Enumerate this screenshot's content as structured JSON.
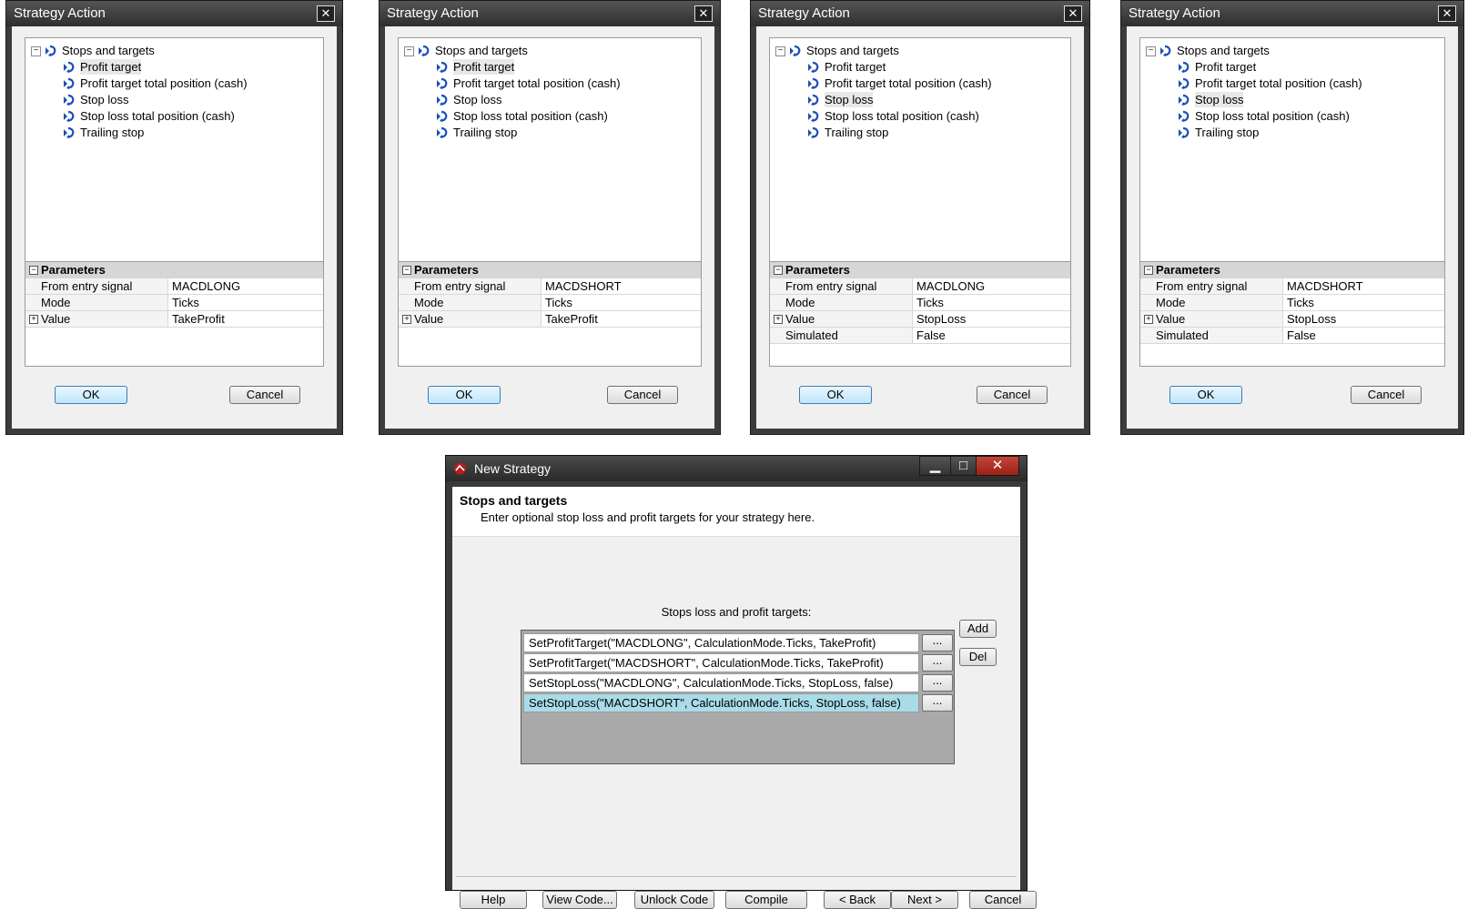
{
  "dialogs": [
    {
      "title": "Strategy Action",
      "close": "✕",
      "tree": {
        "root": "Stops and targets",
        "expander": "−",
        "items": [
          "Profit target",
          "Profit target total position (cash)",
          "Stop loss",
          "Stop loss total position (cash)",
          "Trailing stop"
        ],
        "selected_index": 0
      },
      "params": {
        "header": "Parameters",
        "rows": [
          {
            "name": "From entry signal",
            "value": "MACDLONG"
          },
          {
            "name": "Mode",
            "value": "Ticks"
          },
          {
            "name": "Value",
            "value": "TakeProfit",
            "expandable": true
          }
        ]
      },
      "ok": "OK",
      "cancel": "Cancel"
    },
    {
      "title": "Strategy Action",
      "close": "✕",
      "tree": {
        "root": "Stops and targets",
        "expander": "−",
        "items": [
          "Profit target",
          "Profit target total position (cash)",
          "Stop loss",
          "Stop loss total position (cash)",
          "Trailing stop"
        ],
        "selected_index": 0
      },
      "params": {
        "header": "Parameters",
        "rows": [
          {
            "name": "From entry signal",
            "value": "MACDSHORT"
          },
          {
            "name": "Mode",
            "value": "Ticks"
          },
          {
            "name": "Value",
            "value": "TakeProfit",
            "expandable": true
          }
        ]
      },
      "ok": "OK",
      "cancel": "Cancel"
    },
    {
      "title": "Strategy Action",
      "close": "✕",
      "tree": {
        "root": "Stops and targets",
        "expander": "−",
        "items": [
          "Profit target",
          "Profit target total position (cash)",
          "Stop loss",
          "Stop loss total position (cash)",
          "Trailing stop"
        ],
        "selected_index": 2
      },
      "params": {
        "header": "Parameters",
        "rows": [
          {
            "name": "From entry signal",
            "value": "MACDLONG"
          },
          {
            "name": "Mode",
            "value": "Ticks"
          },
          {
            "name": "Value",
            "value": "StopLoss",
            "expandable": true
          },
          {
            "name": "Simulated",
            "value": "False"
          }
        ]
      },
      "ok": "OK",
      "cancel": "Cancel"
    },
    {
      "title": "Strategy Action",
      "close": "✕",
      "tree": {
        "root": "Stops and targets",
        "expander": "−",
        "items": [
          "Profit target",
          "Profit target total position (cash)",
          "Stop loss",
          "Stop loss total position (cash)",
          "Trailing stop"
        ],
        "selected_index": 2
      },
      "params": {
        "header": "Parameters",
        "rows": [
          {
            "name": "From entry signal",
            "value": "MACDSHORT"
          },
          {
            "name": "Mode",
            "value": "Ticks"
          },
          {
            "name": "Value",
            "value": "StopLoss",
            "expandable": true
          },
          {
            "name": "Simulated",
            "value": "False"
          }
        ]
      },
      "ok": "OK",
      "cancel": "Cancel"
    }
  ],
  "new_strategy": {
    "title": "New Strategy",
    "window_buttons": {
      "minimize": "▁",
      "maximize": "□",
      "close": "✕"
    },
    "header_title": "Stops and targets",
    "header_subtitle": "Enter optional stop loss and profit targets for your strategy here.",
    "list_caption": "Stops loss and profit targets:",
    "entries": [
      "SetProfitTarget(\"MACDLONG\", CalculationMode.Ticks, TakeProfit)",
      "SetProfitTarget(\"MACDSHORT\", CalculationMode.Ticks, TakeProfit)",
      "SetStopLoss(\"MACDLONG\", CalculationMode.Ticks, StopLoss, false)",
      "SetStopLoss(\"MACDSHORT\", CalculationMode.Ticks, StopLoss, false)"
    ],
    "selected_entry": 3,
    "ellipsis": "...",
    "add": "Add",
    "del": "Del",
    "footer_buttons": [
      "Help",
      "View Code...",
      "Unlock Code",
      "Compile",
      "< Back",
      "Next >",
      "Cancel"
    ],
    "accent_color": "#a8dce8"
  }
}
